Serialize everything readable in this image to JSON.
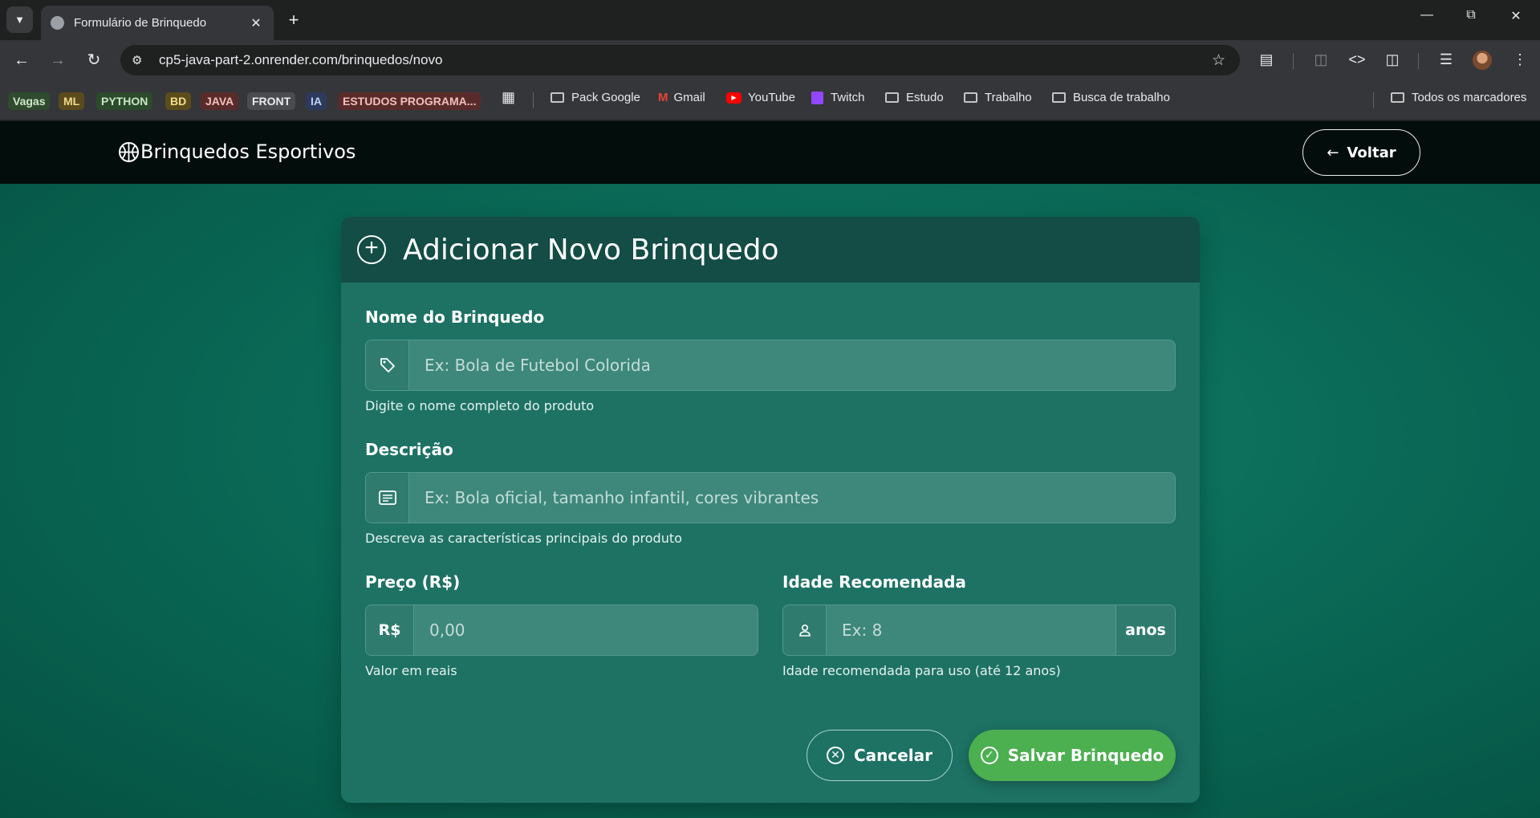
{
  "browser": {
    "tab_title": "Formulário de Brinquedo",
    "url": "cp5-java-part-2.onrender.com/brinquedos/novo",
    "bookmarks": {
      "chips": [
        {
          "label": "Vagas",
          "bg": "#2f4a2f",
          "fg": "#cfe8c8"
        },
        {
          "label": "ML",
          "bg": "#5a4a1e",
          "fg": "#f2d98a"
        },
        {
          "label": "PYTHON",
          "bg": "#2c4a2c",
          "fg": "#c9e7c3"
        },
        {
          "label": "BD",
          "bg": "#5b4c1c",
          "fg": "#f3dc8c"
        },
        {
          "label": "JAVA",
          "bg": "#5a2b2b",
          "fg": "#f2c0bb"
        },
        {
          "label": "FRONT",
          "bg": "#4a4c50",
          "fg": "#e8eaed"
        },
        {
          "label": "IA",
          "bg": "#2c3a5c",
          "fg": "#c2d3f5"
        },
        {
          "label": "ESTUDOS PROGRAMA...",
          "bg": "#5a2b2b",
          "fg": "#f2c0bb"
        }
      ],
      "links": {
        "pack_google": "Pack Google",
        "gmail": "Gmail",
        "youtube": "YouTube",
        "twitch": "Twitch",
        "estudo": "Estudo",
        "trabalho": "Trabalho",
        "busca": "Busca de trabalho",
        "todos": "Todos os marcadores"
      }
    }
  },
  "navbar": {
    "brand": "Brinquedos Esportivos",
    "back_label": "Voltar"
  },
  "form": {
    "title": "Adicionar Novo Brinquedo",
    "nome": {
      "label": "Nome do Brinquedo",
      "placeholder": "Ex: Bola de Futebol Colorida",
      "hint": "Digite o nome completo do produto"
    },
    "descricao": {
      "label": "Descrição",
      "placeholder": "Ex: Bola oficial, tamanho infantil, cores vibrantes",
      "hint": "Descreva as características principais do produto"
    },
    "preco": {
      "label": "Preço (R$)",
      "prefix": "R$",
      "placeholder": "0,00",
      "hint": "Valor em reais"
    },
    "idade": {
      "label": "Idade Recomendada",
      "placeholder": "Ex: 8",
      "suffix": "anos",
      "hint": "Idade recomendada para uso (até 12 anos)"
    },
    "cancel_label": "Cancelar",
    "save_label": "Salvar Brinquedo"
  },
  "colors": {
    "navbar_bg": "#030d0c",
    "card_bg": "#1d7264",
    "card_header_bg": "#134d45",
    "save_button": "#4caf50"
  }
}
